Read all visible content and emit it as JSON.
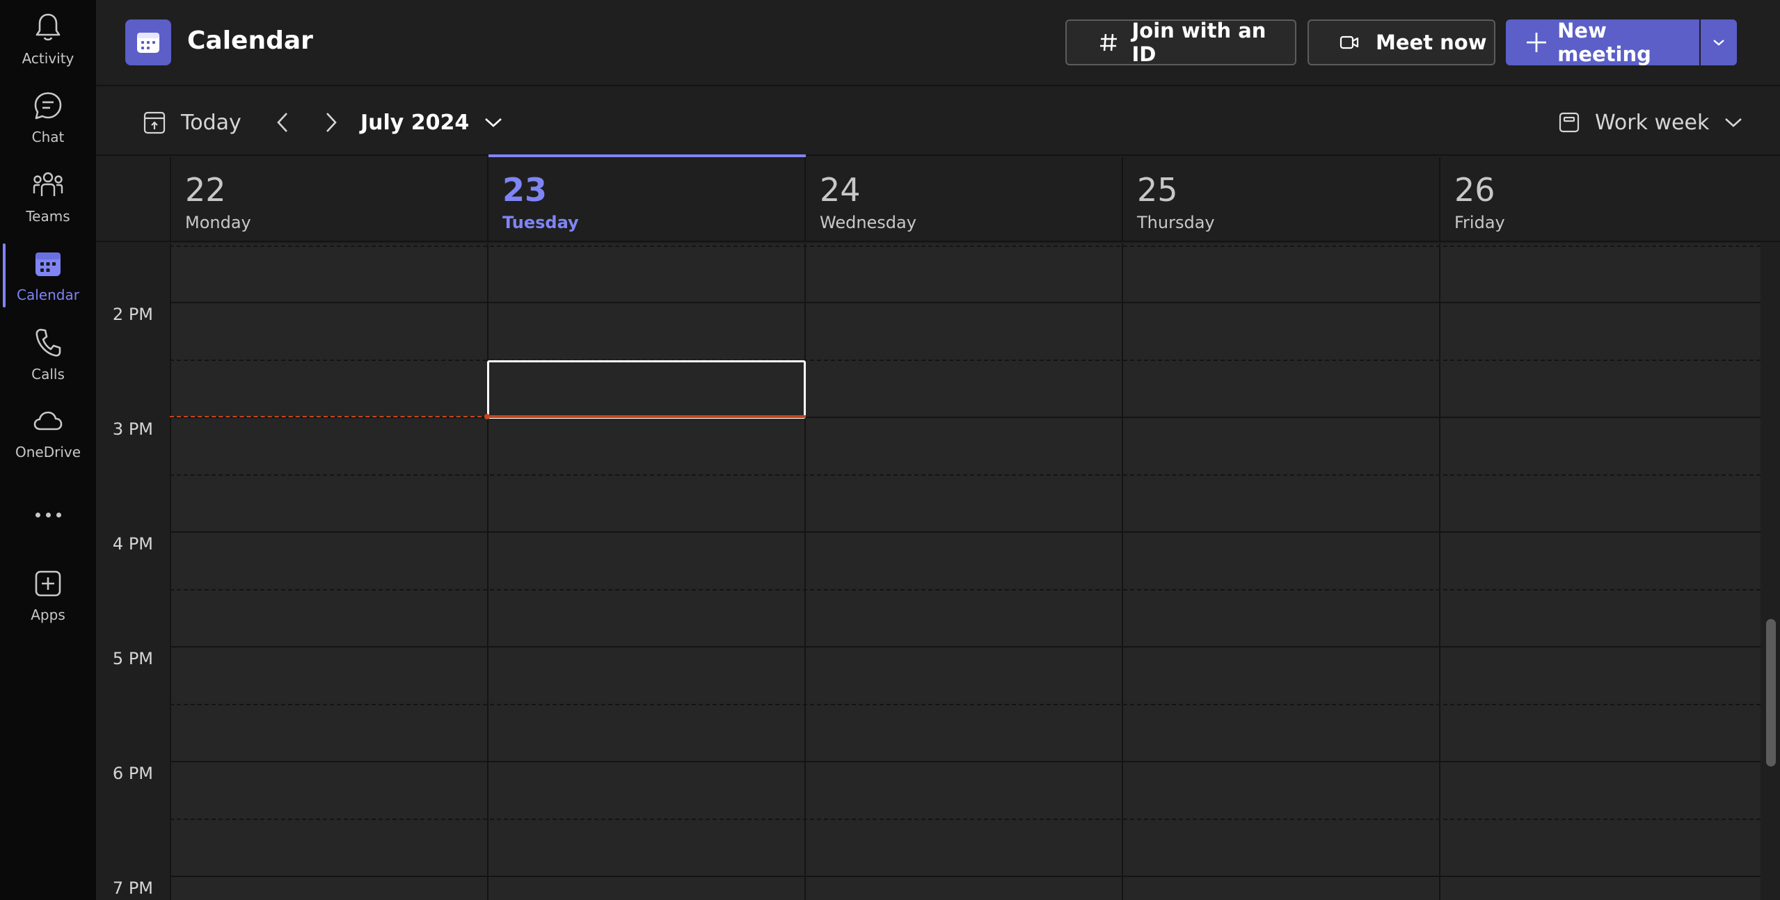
{
  "rail": {
    "items": [
      {
        "label": "Activity",
        "icon": "bell-icon"
      },
      {
        "label": "Chat",
        "icon": "chat-icon"
      },
      {
        "label": "Teams",
        "icon": "teams-icon"
      },
      {
        "label": "Calendar",
        "icon": "calendar-icon",
        "active": true
      },
      {
        "label": "Calls",
        "icon": "phone-icon"
      },
      {
        "label": "OneDrive",
        "icon": "cloud-icon"
      },
      {
        "label": "Apps",
        "icon": "apps-icon"
      }
    ],
    "more_icon": "more-horizontal-icon"
  },
  "header": {
    "title": "Calendar",
    "join_label": "Join with an ID",
    "meet_label": "Meet now",
    "new_label": "New meeting"
  },
  "toolbar": {
    "today_label": "Today",
    "month_label": "July 2024",
    "view_label": "Work week"
  },
  "days": [
    {
      "num": "22",
      "name": "Monday"
    },
    {
      "num": "23",
      "name": "Tuesday",
      "today": true
    },
    {
      "num": "24",
      "name": "Wednesday"
    },
    {
      "num": "25",
      "name": "Thursday"
    },
    {
      "num": "26",
      "name": "Friday"
    }
  ],
  "times": [
    "2 PM",
    "3 PM",
    "4 PM",
    "5 PM",
    "6 PM",
    "7 PM"
  ],
  "colors": {
    "accent": "#7f85f5",
    "brand": "#5b5fc7",
    "now_line": "#c4451c"
  }
}
